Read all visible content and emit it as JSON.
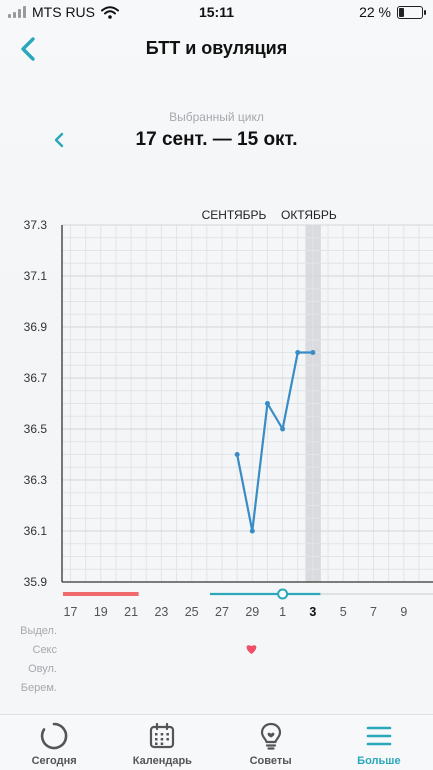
{
  "status_bar": {
    "carrier": "MTS RUS",
    "time": "15:11",
    "battery": "22 %",
    "battery_level": 0.22
  },
  "nav": {
    "title": "БТТ и овуляция",
    "back_icon": "chevron-left-icon"
  },
  "cycle": {
    "caption": "Выбранный цикл",
    "range": "17 сент. — 15 окт.",
    "prev_icon": "chevron-left-icon"
  },
  "colors": {
    "accent": "#2aa7bb",
    "line": "#3a8cc6",
    "period": "#f06a6d",
    "heart": "#ef4f6a",
    "grid": "#e2e5e8",
    "highlight": "#d9dbde"
  },
  "chart_data": {
    "type": "line",
    "title": "",
    "xlabel": "",
    "ylabel": "",
    "month_labels": [
      {
        "label": "СЕНТЯБРЬ",
        "at_day": 27
      },
      {
        "label": "ОКТЯБРЬ",
        "at_day": 3
      }
    ],
    "y_ticks": [
      "37.3",
      "37.1",
      "36.9",
      "36.7",
      "36.5",
      "36.3",
      "36.1",
      "35.9"
    ],
    "ylim": [
      35.9,
      37.3
    ],
    "x_days": [
      17,
      18,
      19,
      20,
      21,
      22,
      23,
      24,
      25,
      26,
      27,
      28,
      29,
      30,
      1,
      2,
      3,
      4,
      5,
      6,
      7,
      8,
      9,
      10
    ],
    "x_ticks": [
      "17",
      "19",
      "21",
      "23",
      "25",
      "27",
      "29",
      "1",
      "3",
      "5",
      "7",
      "9"
    ],
    "today": "3",
    "series": [
      {
        "x": [
          "28",
          "29",
          "30",
          "1",
          "2",
          "3"
        ],
        "values": [
          36.4,
          36.1,
          36.6,
          36.5,
          36.8,
          36.8
        ]
      }
    ],
    "period_days": [
      "17",
      "18",
      "19",
      "20",
      "21"
    ],
    "cycle_days": [
      "27",
      "28",
      "29",
      "30",
      "1",
      "2",
      "3"
    ],
    "marked_day": "1",
    "row_labels": [
      "Выдел.",
      "Секс",
      "Овул.",
      "Берем."
    ],
    "sex_days": [
      "30"
    ],
    "grid": true,
    "legend": "none"
  },
  "tabs": [
    {
      "label": "Сегодня",
      "icon": "circle-icon",
      "active": false
    },
    {
      "label": "Календарь",
      "icon": "calendar-icon",
      "active": false
    },
    {
      "label": "Советы",
      "icon": "lightbulb-icon",
      "active": false
    },
    {
      "label": "Больше",
      "icon": "menu-icon",
      "active": true
    }
  ]
}
